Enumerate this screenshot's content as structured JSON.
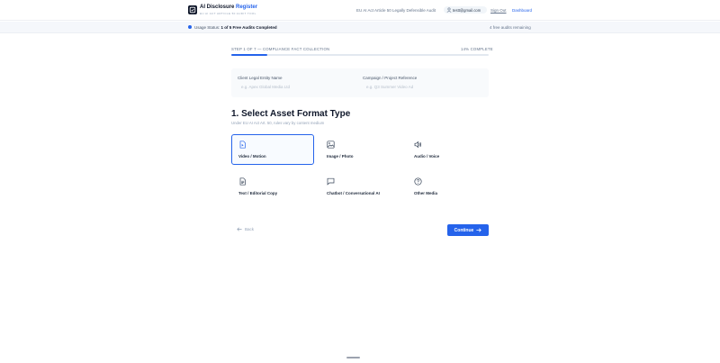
{
  "header": {
    "brand_main": "AI Disclosure ",
    "brand_accent": "Register",
    "brand_sub": "EU AI ACT ARTICLE 50 AUDIT TOOL",
    "tagline": "EU AI Act Article 50 Legally Defensible Audit",
    "user_email": "testt@gmail.com",
    "signout_label": "Sign Out",
    "dashboard_label": "Dashboard"
  },
  "usage": {
    "label": "Usage Status: ",
    "status": "1 of 5 Free Audits Completed",
    "remaining": "4 free audits remaining"
  },
  "progress": {
    "step_label": "STEP 1 OF 7 — COMPLIANCE FACT COLLECTION",
    "percent_label": "14% COMPLETE",
    "percent": 14
  },
  "client": {
    "entity_label": "Client Legal Entity Name",
    "entity_placeholder": "e.g. Apex Global Media Ltd",
    "campaign_label": "Campaign / Project Reference",
    "campaign_placeholder": "e.g. Q3 Summer Video Ad"
  },
  "section": {
    "title": "1. Select Asset Format Type",
    "subtitle": "Under EU AI Act Art. 50, rules vary by content medium"
  },
  "options": [
    {
      "label": "Video / Motion",
      "icon": "file-video-icon",
      "selected": true
    },
    {
      "label": "Image / Photo",
      "icon": "image-icon",
      "selected": false
    },
    {
      "label": "Audio / Voice",
      "icon": "speaker-icon",
      "selected": false
    },
    {
      "label": "Text / Editorial Copy",
      "icon": "file-text-icon",
      "selected": false
    },
    {
      "label": "Chatbot / Conversational AI",
      "icon": "chat-icon",
      "selected": false
    },
    {
      "label": "Other Media",
      "icon": "help-circle-icon",
      "selected": false
    }
  ],
  "actions": {
    "back_label": "Back",
    "continue_label": "Continue"
  },
  "colors": {
    "accent": "#2563eb",
    "dark": "#0f172a"
  }
}
